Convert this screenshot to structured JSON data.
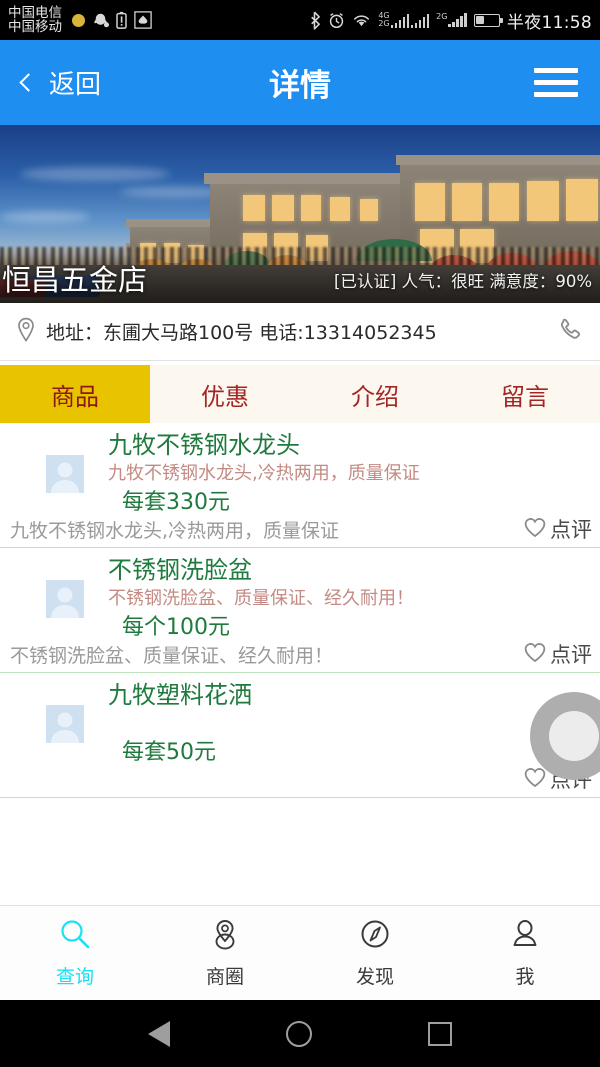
{
  "status_bar": {
    "carrier_primary": "中国电信",
    "carrier_secondary": "中国移动",
    "icons": [
      "dot-icon",
      "qq-icon",
      "battery-saver-icon",
      "huawei-icon",
      "bluetooth-icon",
      "alarm-icon",
      "wifi-icon"
    ],
    "signal_1_labels": [
      "4G",
      "2G"
    ],
    "signal_2_label": "2G",
    "time": "半夜11:58"
  },
  "header": {
    "back_label": "返回",
    "title": "详情",
    "menu_icon": "hamburger-icon"
  },
  "shop": {
    "name": "恒昌五金店",
    "meta": "[已认证] 人气：很旺 满意度：90%",
    "address_line": "地址：东圃大马路100号 电话:13314052345",
    "location_icon": "location-pin-icon",
    "call_icon": "phone-icon"
  },
  "tabs": [
    {
      "label": "商品",
      "active": true
    },
    {
      "label": "优惠",
      "active": false
    },
    {
      "label": "介绍",
      "active": false
    },
    {
      "label": "留言",
      "active": false
    }
  ],
  "products": [
    {
      "title": "九牧不锈钢水龙头",
      "desc": "九牧不锈钢水龙头,冷热两用，质量保证",
      "price": "每套330元",
      "footer": "九牧不锈钢水龙头,冷热两用，质量保证",
      "review_label": "点评"
    },
    {
      "title": "不锈钢洗脸盆",
      "desc": "不锈钢洗脸盆、质量保证、经久耐用！",
      "price": "每个100元",
      "footer": "不锈钢洗脸盆、质量保证、经久耐用！",
      "review_label": "点评"
    },
    {
      "title": "九牧塑料花洒",
      "desc": "",
      "price": "每套50元",
      "footer": "",
      "review_label": "点评"
    }
  ],
  "bottom_nav": [
    {
      "label": "查询",
      "icon": "search-icon",
      "active": true
    },
    {
      "label": "商圈",
      "icon": "location-pin-icon",
      "active": false
    },
    {
      "label": "发现",
      "icon": "compass-icon",
      "active": false
    },
    {
      "label": "我",
      "icon": "person-icon",
      "active": false
    }
  ],
  "android_nav": {
    "back": "back-triangle-icon",
    "home": "home-circle-icon",
    "recents": "recents-square-icon"
  },
  "colors": {
    "header_blue": "#1f8ef1",
    "tab_active_bg": "#e8c300",
    "tab_text": "#a32626",
    "price_green": "#1f7a3d",
    "desc_pink": "#c48b84",
    "nav_active_cyan": "#18e0f5"
  }
}
